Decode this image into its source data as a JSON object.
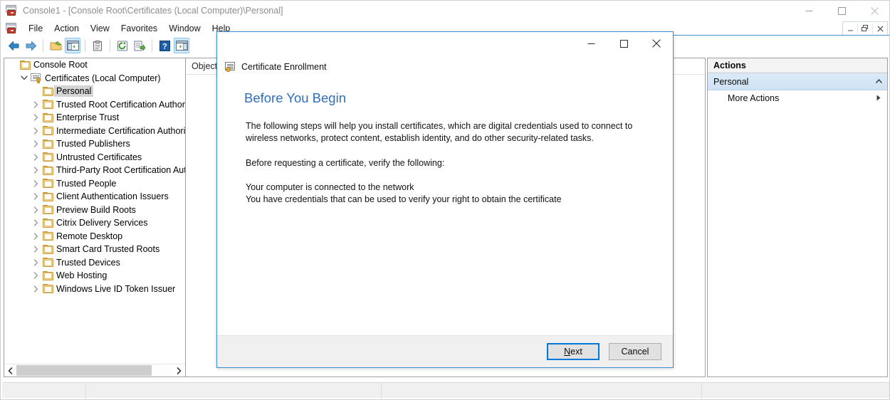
{
  "window": {
    "title": "Console1 - [Console Root\\Certificates (Local Computer)\\Personal]",
    "icon": "mmc-console-icon",
    "controls": {
      "minimize": "minimize-icon",
      "maximize": "maximize-icon",
      "close": "close-icon"
    },
    "mdi_controls": {
      "minimize": "mdi-minimize-icon",
      "restore": "mdi-restore-icon",
      "close": "mdi-close-icon"
    }
  },
  "menubar": {
    "icon": "mmc-console-icon",
    "items": [
      {
        "label": "File"
      },
      {
        "label": "Action"
      },
      {
        "label": "View"
      },
      {
        "label": "Favorites"
      },
      {
        "label": "Window"
      },
      {
        "label": "Help"
      }
    ]
  },
  "toolbar": {
    "buttons": [
      {
        "name": "back-button",
        "icon": "arrow-left-icon",
        "active": false
      },
      {
        "name": "forward-button",
        "icon": "arrow-right-icon",
        "active": false
      },
      {
        "name": "up-one-level-button",
        "icon": "folder-up-icon",
        "active": false
      },
      {
        "name": "show-hide-console-tree-button",
        "icon": "console-tree-icon",
        "active": true
      },
      {
        "name": "properties-button",
        "icon": "clipboard-icon",
        "active": false
      },
      {
        "name": "refresh-button",
        "icon": "refresh-icon",
        "active": false
      },
      {
        "name": "export-list-button",
        "icon": "export-list-icon",
        "active": false
      },
      {
        "name": "help-button",
        "icon": "question-mark-icon",
        "active": false
      },
      {
        "name": "show-hide-action-pane-button",
        "icon": "action-pane-icon",
        "active": true
      }
    ]
  },
  "tree": {
    "nodes": [
      {
        "label": "Console Root",
        "depth": 0,
        "expander": "none",
        "icon": "folder-icon",
        "selected": false
      },
      {
        "label": "Certificates (Local Computer)",
        "depth": 1,
        "expander": "expanded",
        "icon": "certificate-store-icon",
        "selected": false
      },
      {
        "label": "Personal",
        "depth": 2,
        "expander": "none",
        "icon": "folder-icon",
        "selected": true
      },
      {
        "label": "Trusted Root Certification Authorities",
        "depth": 2,
        "expander": "collapsed",
        "icon": "folder-icon",
        "selected": false
      },
      {
        "label": "Enterprise Trust",
        "depth": 2,
        "expander": "collapsed",
        "icon": "folder-icon",
        "selected": false
      },
      {
        "label": "Intermediate Certification Authorities",
        "depth": 2,
        "expander": "collapsed",
        "icon": "folder-icon",
        "selected": false
      },
      {
        "label": "Trusted Publishers",
        "depth": 2,
        "expander": "collapsed",
        "icon": "folder-icon",
        "selected": false
      },
      {
        "label": "Untrusted Certificates",
        "depth": 2,
        "expander": "collapsed",
        "icon": "folder-icon",
        "selected": false
      },
      {
        "label": "Third-Party Root Certification Authorities",
        "depth": 2,
        "expander": "collapsed",
        "icon": "folder-icon",
        "selected": false
      },
      {
        "label": "Trusted People",
        "depth": 2,
        "expander": "collapsed",
        "icon": "folder-icon",
        "selected": false
      },
      {
        "label": "Client Authentication Issuers",
        "depth": 2,
        "expander": "collapsed",
        "icon": "folder-icon",
        "selected": false
      },
      {
        "label": "Preview Build Roots",
        "depth": 2,
        "expander": "collapsed",
        "icon": "folder-icon",
        "selected": false
      },
      {
        "label": "Citrix Delivery Services",
        "depth": 2,
        "expander": "collapsed",
        "icon": "folder-icon",
        "selected": false
      },
      {
        "label": "Remote Desktop",
        "depth": 2,
        "expander": "collapsed",
        "icon": "folder-icon",
        "selected": false
      },
      {
        "label": "Smart Card Trusted Roots",
        "depth": 2,
        "expander": "collapsed",
        "icon": "folder-icon",
        "selected": false
      },
      {
        "label": "Trusted Devices",
        "depth": 2,
        "expander": "collapsed",
        "icon": "folder-icon",
        "selected": false
      },
      {
        "label": "Web Hosting",
        "depth": 2,
        "expander": "collapsed",
        "icon": "folder-icon",
        "selected": false
      },
      {
        "label": "Windows Live ID Token Issuer",
        "depth": 2,
        "expander": "collapsed",
        "icon": "folder-icon",
        "selected": false
      }
    ],
    "hscroll": {
      "left_arrow": "chevron-left-icon",
      "right_arrow": "chevron-right-icon"
    }
  },
  "result_pane": {
    "columns": [
      {
        "label": "Object"
      }
    ],
    "rows": []
  },
  "actions_pane": {
    "title": "Actions",
    "group": {
      "label": "Personal",
      "chevron": "chevron-up-icon"
    },
    "items": [
      {
        "label": "More Actions",
        "chevron": "chevron-right-icon"
      }
    ]
  },
  "statusbar": {
    "text": ""
  },
  "dialog": {
    "title": "Certificate Enrollment",
    "icon": "certificate-enrollment-icon",
    "controls": {
      "minimize": "minimize-icon",
      "maximize": "maximize-icon",
      "close": "close-icon"
    },
    "heading": "Before You Begin",
    "paragraphs": [
      "The following steps will help you install certificates, which are digital credentials used to connect to wireless networks, protect content, establish identity, and do other security-related tasks.",
      "Before requesting a certificate, verify the following:"
    ],
    "checklist": [
      "Your computer is connected to the network",
      "You have credentials that can be used to verify your right to obtain the certificate"
    ],
    "buttons": {
      "next": {
        "accel": "N",
        "rest": "ext",
        "default": true
      },
      "cancel": {
        "label": "Cancel",
        "default": false
      }
    }
  },
  "colors": {
    "accent": "#0078d7",
    "heading": "#2e6fbb",
    "dialog_border": "#3c8fd4",
    "selection": "#d4d4d4",
    "actions_group": "#cfe2f4",
    "folder": "#fbd78b"
  }
}
